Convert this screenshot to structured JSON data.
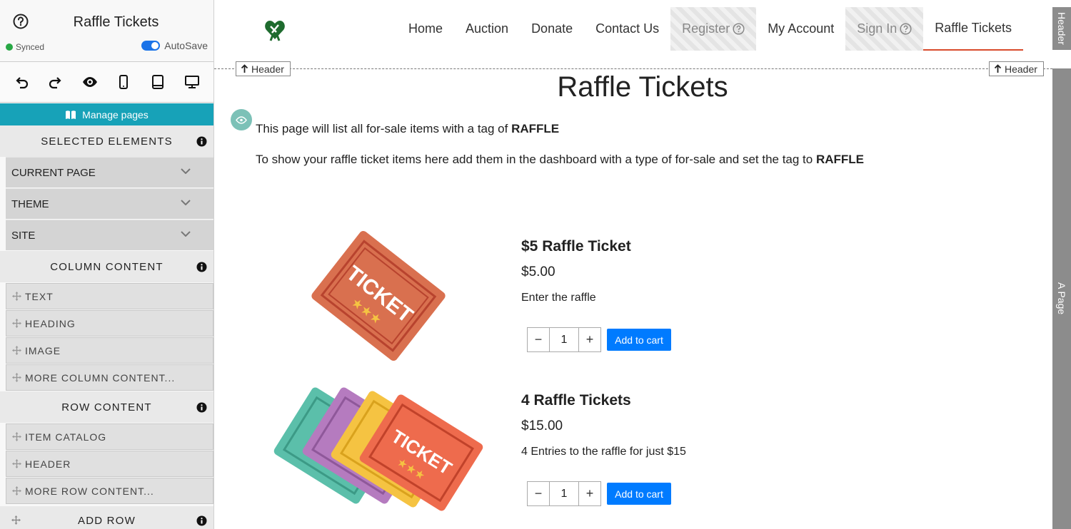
{
  "sidebar": {
    "title": "Raffle Tickets",
    "sync_status": "Synced",
    "autosave_label": "AutoSave",
    "manage_pages": "Manage pages",
    "selected_elements": {
      "heading": "SELECTED ELEMENTS",
      "items": [
        "CURRENT PAGE",
        "THEME",
        "SITE"
      ]
    },
    "column_content": {
      "heading": "COLUMN CONTENT",
      "items": [
        "TEXT",
        "HEADING",
        "IMAGE",
        "MORE COLUMN CONTENT..."
      ]
    },
    "row_content": {
      "heading": "ROW CONTENT",
      "items": [
        "ITEM CATALOG",
        "HEADER",
        "MORE ROW CONTENT..."
      ]
    },
    "add_row": "ADD ROW"
  },
  "nav": {
    "items": [
      "Home",
      "Auction",
      "Donate",
      "Contact Us",
      "Register",
      "My Account",
      "Sign In",
      "Raffle Tickets"
    ]
  },
  "header_tag": "Header",
  "page_tag": "A Page",
  "header_button": "Header",
  "page": {
    "title": "Raffle Tickets",
    "intro_prefix": "This page will list all for-sale items with a tag of ",
    "intro_tag": "RAFFLE",
    "instructions_prefix": "To show your raffle ticket items here add them in the dashboard with a type of for-sale and set the tag to ",
    "instructions_tag": "RAFFLE"
  },
  "products": [
    {
      "name": "$5 Raffle Ticket",
      "price": "$5.00",
      "description": "Enter the raffle",
      "quantity": "1",
      "button": "Add to cart",
      "image_text": "TICKET"
    },
    {
      "name": "4 Raffle Tickets",
      "price": "$15.00",
      "description": "4 Entries to the raffle for just $15",
      "quantity": "1",
      "button": "Add to cart",
      "image_text": "TICKET"
    }
  ],
  "colors": {
    "accent": "#17a2b8",
    "primary_button": "#007bff",
    "active_underline": "#d94a2b",
    "synced_dot": "#28a745",
    "logo": "#1e6b2e"
  }
}
